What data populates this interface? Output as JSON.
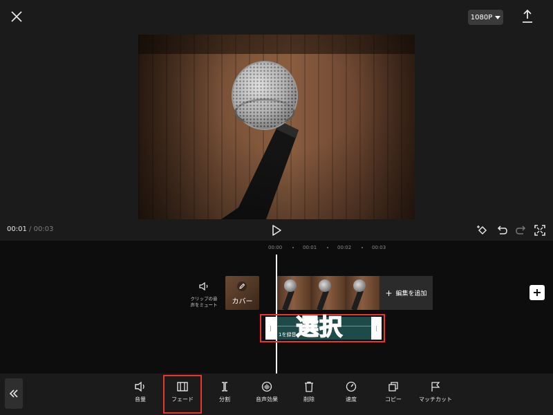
{
  "header": {
    "resolution": "1080P"
  },
  "player": {
    "current_time": "00:01",
    "separator": "/",
    "total_time": "00:03"
  },
  "timeline": {
    "ticks": [
      "00:00",
      "00:01",
      "00:02",
      "00:03"
    ],
    "mute_label_line1": "クリップの音",
    "mute_label_line2": "声をミュート",
    "cover_label": "カバー",
    "add_edit_label": "編集を追加",
    "audio_clip_name": "1を録音",
    "annotation_select": "選択"
  },
  "toolbar": {
    "tools": [
      {
        "label": "音量",
        "icon": "volume-icon"
      },
      {
        "label": "フェード",
        "icon": "fade-icon"
      },
      {
        "label": "分割",
        "icon": "split-icon"
      },
      {
        "label": "音声効果",
        "icon": "voice-effect-icon"
      },
      {
        "label": "削除",
        "icon": "trash-icon"
      },
      {
        "label": "速度",
        "icon": "speed-icon"
      },
      {
        "label": "コピー",
        "icon": "copy-icon"
      },
      {
        "label": "マッチカット",
        "icon": "flag-icon"
      }
    ]
  },
  "colors": {
    "background": "#1b1b1b",
    "timeline_bg": "#0d0d0d",
    "highlight_red": "#e8352d",
    "audio_clip": "#1f4a4a"
  }
}
